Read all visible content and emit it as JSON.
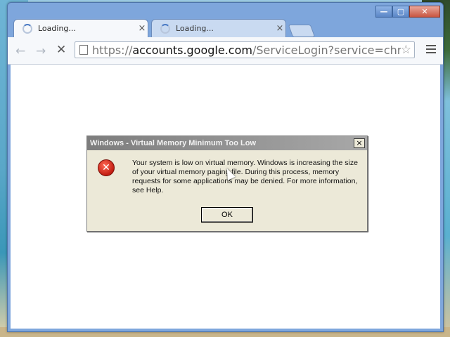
{
  "browser": {
    "tabs": [
      {
        "label": "Loading...",
        "active": true
      },
      {
        "label": "Loading...",
        "active": false
      }
    ],
    "address": {
      "scheme": "https://",
      "host": "accounts.google.com",
      "path": "/ServiceLogin?service=chromiur"
    },
    "window_controls": [
      "minimize",
      "maximize",
      "close"
    ]
  },
  "dialog": {
    "title": "Windows - Virtual Memory Minimum Too Low",
    "message": "Your system is low on virtual memory. Windows is increasing the size of your virtual memory paging file. During this process, memory requests for some applications may be denied. For more information, see Help.",
    "ok_label": "OK",
    "close_symbol": "×",
    "icon": "error-icon"
  },
  "icons": {
    "back": "←",
    "forward": "→",
    "stop": "✕",
    "star": "☆",
    "tab_close": "×",
    "error_glyph": "✕",
    "minimize": "—",
    "maximize": "▢",
    "close": "✕"
  }
}
